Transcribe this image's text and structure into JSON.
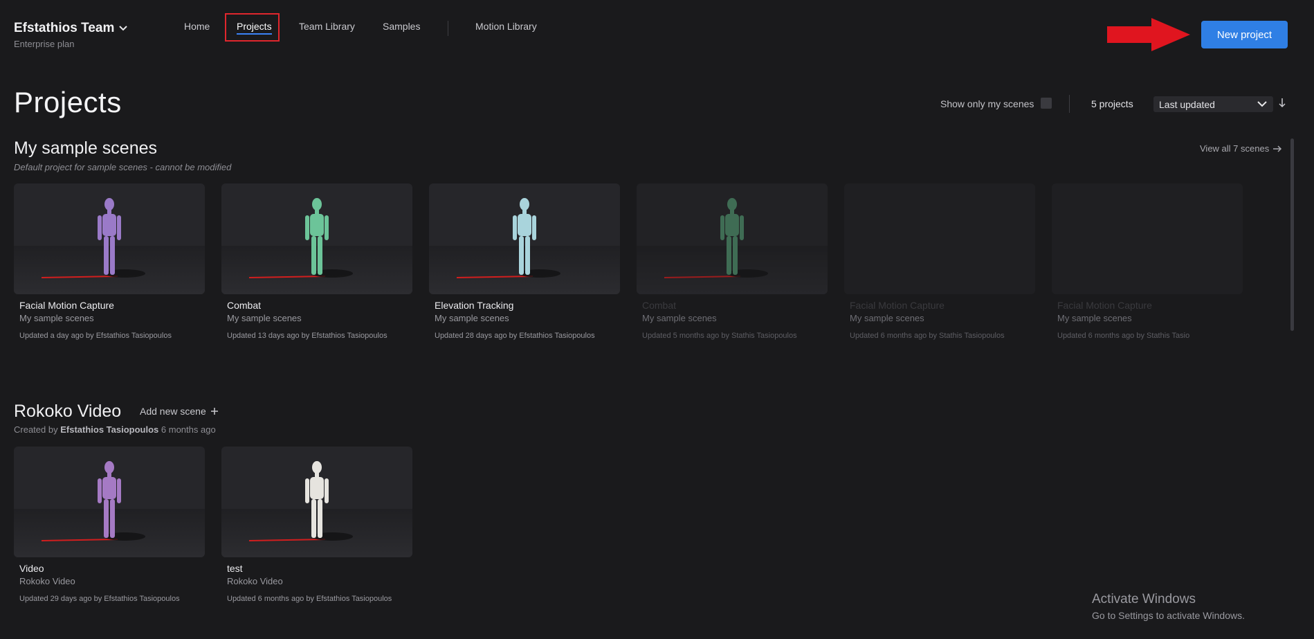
{
  "header": {
    "team_name": "Efstathios Team",
    "plan": "Enterprise plan",
    "nav": [
      {
        "label": "Home"
      },
      {
        "label": "Projects",
        "active": true
      },
      {
        "label": "Team Library"
      },
      {
        "label": "Samples"
      },
      {
        "label": "Motion Library"
      }
    ],
    "new_project_label": "New project"
  },
  "page": {
    "title": "Projects",
    "show_only_mine_label": "Show only my scenes",
    "project_count": "5 projects",
    "sort_value": "Last updated"
  },
  "sections": [
    {
      "title": "My sample scenes",
      "subtitle": "Default project for sample scenes - cannot be modified",
      "view_all_label": "View all 7 scenes",
      "cards": [
        {
          "title": "Facial Motion Capture",
          "project": "My sample scenes",
          "meta": "Updated a day ago by Efstathios Tasiopoulos",
          "figure_color": "#9a7ac8"
        },
        {
          "title": "Combat",
          "project": "My sample scenes",
          "meta": "Updated 13 days ago by Efstathios Tasiopoulos",
          "figure_color": "#6cc499"
        },
        {
          "title": "Elevation Tracking",
          "project": "My sample scenes",
          "meta": "Updated 28 days ago by Efstathios Tasiopoulos",
          "figure_color": "#a9d4dc"
        },
        {
          "title": "Combat",
          "project": "My sample scenes",
          "meta": "Updated 5 months ago by Stathis Tasiopoulos",
          "figure_color": "#4f8f6c"
        },
        {
          "title": "Facial Motion Capture",
          "project": "My sample scenes",
          "meta": "Updated 6 months ago by Stathis Tasiopoulos",
          "figure_color": ""
        },
        {
          "title": "Facial Motion Capture",
          "project": "My sample scenes",
          "meta": "Updated 6 months ago by Stathis Tasio",
          "figure_color": ""
        }
      ]
    },
    {
      "title": "Rokoko Video",
      "add_scene_label": "Add new scene",
      "created_prefix": "Created by",
      "created_by": "Efstathios Tasiopoulos",
      "created_when": "6 months ago",
      "cards": [
        {
          "title": "Video",
          "project": "Rokoko Video",
          "meta": "Updated 29 days ago by Efstathios Tasiopoulos",
          "figure_color": "#a57ac4"
        },
        {
          "title": "test",
          "project": "Rokoko Video",
          "meta": "Updated 6 months ago by Efstathios Tasiopoulos",
          "figure_color": "#e6e4df"
        }
      ]
    }
  ],
  "watermark": {
    "title": "Activate Windows",
    "subtitle": "Go to Settings to activate Windows."
  },
  "colors": {
    "background": "#1a1a1c",
    "accent": "#2f7fe5",
    "highlight": "#e0262d"
  }
}
